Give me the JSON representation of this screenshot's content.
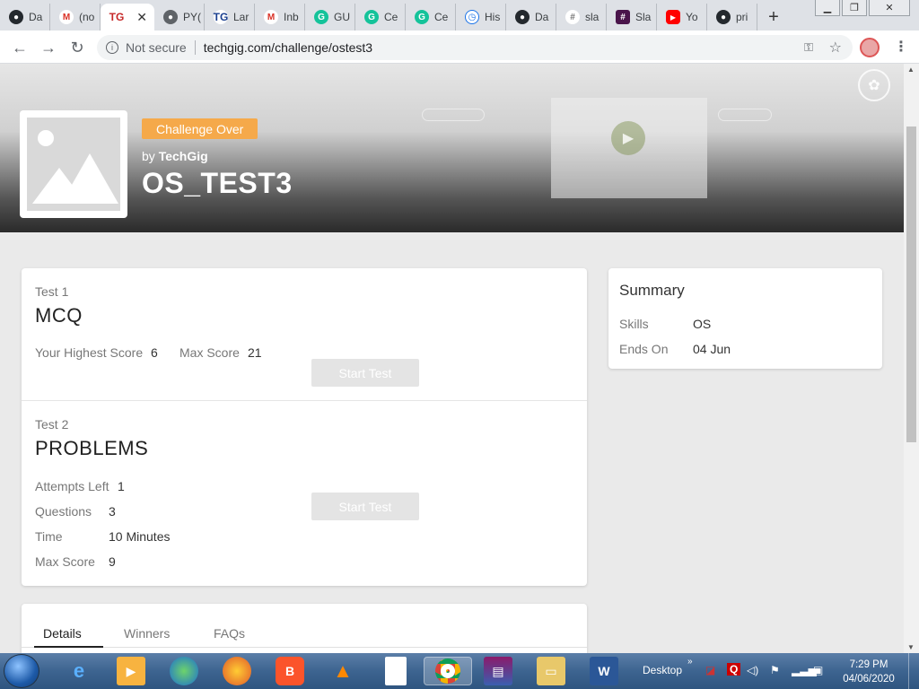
{
  "browser": {
    "tabs": [
      {
        "label": "Da",
        "icon": "github-icon",
        "color": "#24292e"
      },
      {
        "label": "(no",
        "icon": "gmail-icon",
        "color": "#d93025"
      },
      {
        "label": "TG",
        "icon": "techgig-icon",
        "color": "#1a3f8f",
        "active": true
      },
      {
        "label": "PY(",
        "icon": "globe-icon",
        "color": "#5f6368"
      },
      {
        "label": "Lar",
        "icon": "techgig-icon",
        "color": "#1a3f8f"
      },
      {
        "label": "Inb",
        "icon": "gmail-icon",
        "color": "#d93025"
      },
      {
        "label": "GU",
        "icon": "grammarly-icon",
        "color": "#15c39a"
      },
      {
        "label": "Ce",
        "icon": "grammarly-icon",
        "color": "#15c39a"
      },
      {
        "label": "Ce",
        "icon": "grammarly-icon",
        "color": "#15c39a"
      },
      {
        "label": "His",
        "icon": "history-icon",
        "color": "#1a73e8"
      },
      {
        "label": "Da",
        "icon": "github-icon",
        "color": "#24292e"
      },
      {
        "label": "sla",
        "icon": "slack-icon",
        "color": "#777"
      },
      {
        "label": "Sla",
        "icon": "slack-icon",
        "color": "#4a154b"
      },
      {
        "label": "Yo",
        "icon": "youtube-icon",
        "color": "#ff0000"
      },
      {
        "label": "pri",
        "icon": "github-icon",
        "color": "#24292e"
      }
    ],
    "active_tab_close": "✕",
    "new_tab": "+",
    "security_label": "Not secure",
    "url": "techgig.com/challenge/ostest3"
  },
  "hero": {
    "badge": "Challenge Over",
    "by_prefix": "by",
    "by_name": "TechGig",
    "title": "OS_TEST3"
  },
  "tests": {
    "test1": {
      "number": "Test 1",
      "name": "MCQ",
      "highest_label": "Your Highest Score",
      "highest_value": "6",
      "max_label": "Max Score",
      "max_value": "21",
      "button": "Start Test"
    },
    "test2": {
      "number": "Test 2",
      "name": "PROBLEMS",
      "attempts_label": "Attempts Left",
      "attempts_value": "1",
      "questions_label": "Questions",
      "questions_value": "3",
      "time_label": "Time",
      "time_value": "10 Minutes",
      "max_label": "Max Score",
      "max_value": "9",
      "button": "Start Test"
    }
  },
  "summary": {
    "title": "Summary",
    "skills_label": "Skills",
    "skills_value": "OS",
    "ends_label": "Ends On",
    "ends_value": "04 Jun"
  },
  "details_tabs": [
    "Details",
    "Winners",
    "FAQs"
  ],
  "taskbar": {
    "desktop_label": "Desktop",
    "time": "7:29 PM",
    "date": "04/06/2020"
  },
  "colors": {
    "badge": "#f5a94a",
    "disabled_button": "#e4e4e4"
  }
}
